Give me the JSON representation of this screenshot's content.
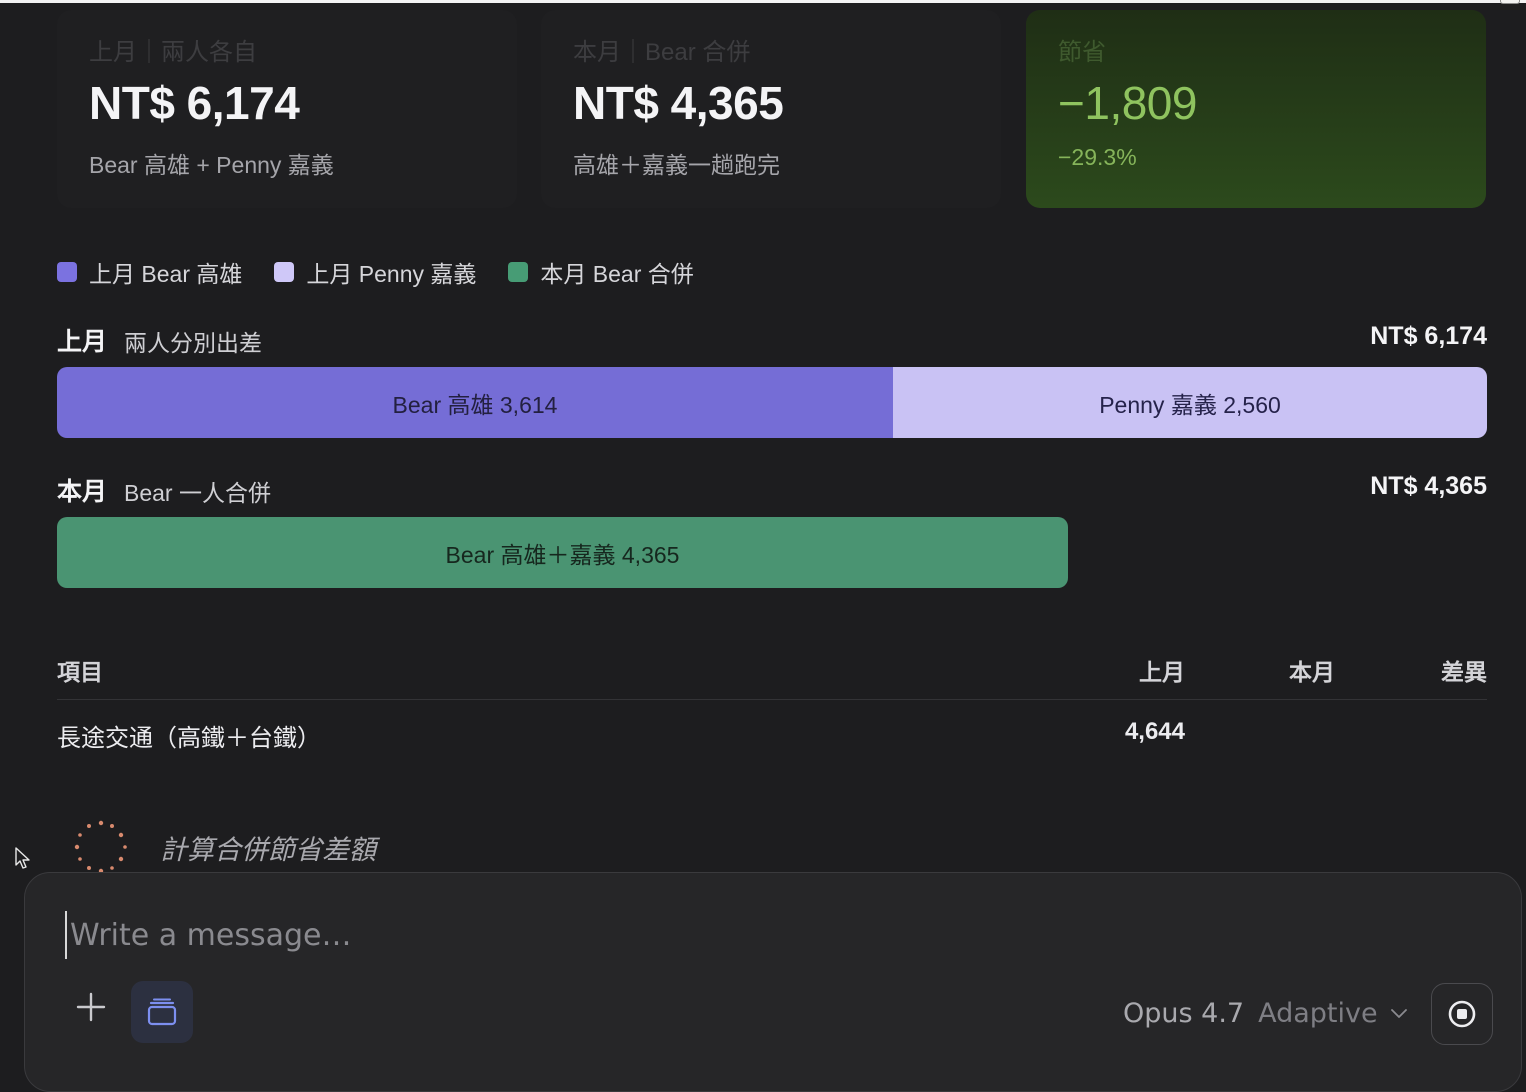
{
  "summary": {
    "last_month": {
      "label": "上月｜兩人各自",
      "value": "NT$ 6,174",
      "sub": "Bear 高雄 + Penny 嘉義"
    },
    "this_month": {
      "label": "本月｜Bear 合併",
      "value": "NT$ 4,365",
      "sub": "高雄＋嘉義一趟跑完"
    },
    "savings": {
      "label": "節省",
      "value": "−1,809",
      "sub": "−29.3%"
    }
  },
  "legend": [
    {
      "label": "上月 Bear 高雄",
      "color": "#7b72e0"
    },
    {
      "label": "上月 Penny 嘉義",
      "color": "#cfc8f8"
    },
    {
      "label": "本月 Bear 合併",
      "color": "#479c75"
    }
  ],
  "chart_data": {
    "type": "bar",
    "orientation": "horizontal-stacked",
    "rows": [
      {
        "label": "上月",
        "description": "兩人分別出差",
        "total_label": "NT$ 6,174",
        "segments": [
          {
            "name": "Bear 高雄",
            "value": 3614,
            "label": "Bear 高雄 3,614",
            "color": "#756dd6"
          },
          {
            "name": "Penny 嘉義",
            "value": 2560,
            "label": "Penny 嘉義 2,560",
            "color": "#c9c2f4"
          }
        ]
      },
      {
        "label": "本月",
        "description": "Bear 一人合併",
        "total_label": "NT$ 4,365",
        "segments": [
          {
            "name": "Bear 高雄＋嘉義",
            "value": 4365,
            "label": "Bear 高雄＋嘉義 4,365",
            "color": "#4a9472"
          }
        ]
      }
    ],
    "xlim": [
      0,
      6174
    ]
  },
  "table": {
    "headers": {
      "item": "項目",
      "prev": "上月",
      "cur": "本月",
      "diff": "差異"
    },
    "rows": [
      {
        "item": "長途交通（高鐵＋台鐵）",
        "prev": "4,644",
        "cur": "",
        "diff": ""
      }
    ]
  },
  "status": {
    "thinking": "計算合併節省差額"
  },
  "composer": {
    "placeholder": "Write a message…",
    "model": "Opus 4.7",
    "mode": "Adaptive",
    "icons": {
      "add": "plus-icon",
      "tool": "archive-box-icon",
      "stop": "stop-icon",
      "dropdown": "chevron-down-icon"
    }
  }
}
